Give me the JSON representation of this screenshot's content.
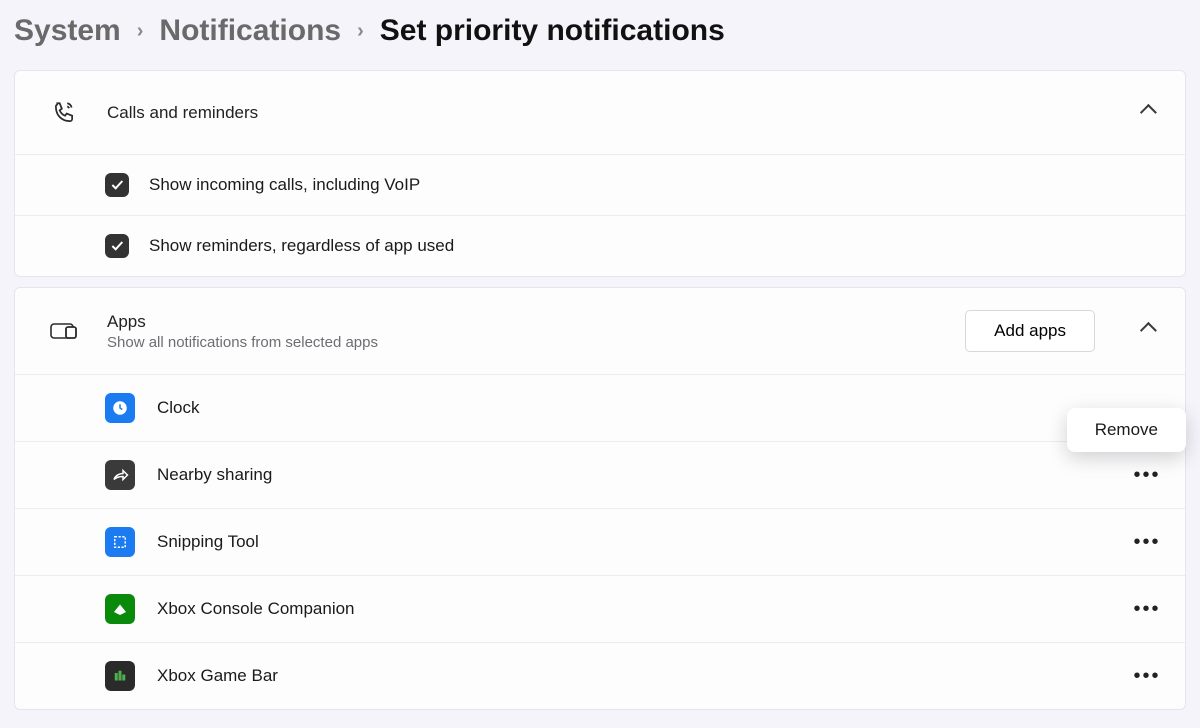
{
  "breadcrumb": {
    "level1": "System",
    "level2": "Notifications",
    "current": "Set priority notifications"
  },
  "callsSection": {
    "title": "Calls and reminders",
    "items": [
      {
        "label": "Show incoming calls, including VoIP",
        "checked": true
      },
      {
        "label": "Show reminders, regardless of app used",
        "checked": true
      }
    ]
  },
  "appsSection": {
    "title": "Apps",
    "subtitle": "Show all notifications from selected apps",
    "addButton": "Add apps",
    "apps": [
      {
        "name": "Clock",
        "iconBg": "bg-blue",
        "icon": "clock"
      },
      {
        "name": "Nearby sharing",
        "iconBg": "bg-dark",
        "icon": "share"
      },
      {
        "name": "Snipping Tool",
        "iconBg": "bg-blue",
        "icon": "snip"
      },
      {
        "name": "Xbox Console Companion",
        "iconBg": "bg-green",
        "icon": "xbox"
      },
      {
        "name": "Xbox Game Bar",
        "iconBg": "bg-dark2",
        "icon": "gamebar"
      }
    ]
  },
  "popup": {
    "remove": "Remove"
  }
}
